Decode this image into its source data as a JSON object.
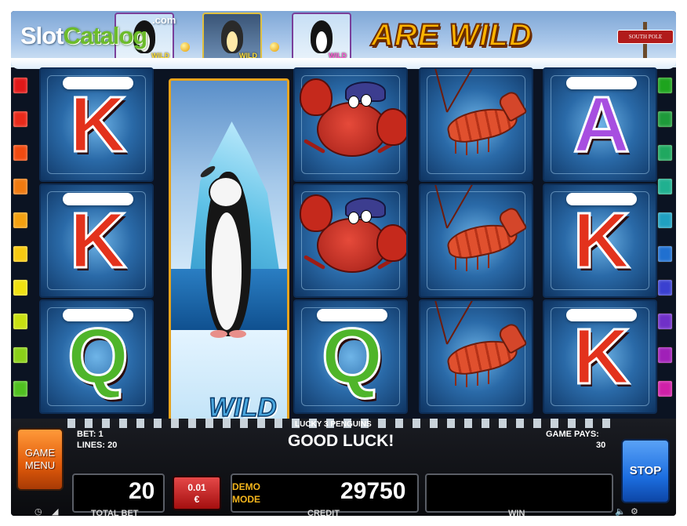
{
  "watermark": {
    "brand_a": "Slot",
    "brand_b": "Catalog",
    "suffix": ".com"
  },
  "header": {
    "headline": "ARE WILD",
    "sign": "SOUTH POLE",
    "wild_thumbs": [
      {
        "label": "WILD",
        "selected": false
      },
      {
        "label": "WILD",
        "selected": true
      },
      {
        "label": "WILD",
        "selected": false
      }
    ]
  },
  "reels": [
    {
      "symbols": [
        "K",
        "K",
        "Q"
      ]
    },
    {
      "symbols": [
        "WILD"
      ]
    },
    {
      "symbols": [
        "crab",
        "crab",
        "Q"
      ]
    },
    {
      "symbols": [
        "shrimp",
        "shrimp",
        "shrimp"
      ]
    },
    {
      "symbols": [
        "A",
        "K",
        "K"
      ]
    }
  ],
  "wild_label": "WILD",
  "line_marker_colors_left": [
    "#e01818",
    "#e82a1a",
    "#f04a10",
    "#f07a10",
    "#f4a010",
    "#f6c810",
    "#f0e010",
    "#c8e010",
    "#8ad018",
    "#50c020"
  ],
  "line_marker_colors_right": [
    "#1ea41e",
    "#1e9a3a",
    "#20a860",
    "#20b090",
    "#20a0c0",
    "#2070d0",
    "#3a40d0",
    "#7030c8",
    "#a020b8",
    "#d020a8"
  ],
  "panel": {
    "game_menu_line1": "GAME",
    "game_menu_line2": "MENU",
    "bet_label": "BET: 1",
    "lines_label": "LINES: 20",
    "game_title": "LUCKY 3 PENGUINS",
    "message": "GOOD LUCK!",
    "game_pays_label": "GAME PAYS:",
    "game_pays_value": "30",
    "total_bet_value": "20",
    "total_bet_caption": "TOTAL BET",
    "denomination_value": "0.01",
    "denomination_currency": "€",
    "demo_line1": "DEMO",
    "demo_line2": "MODE",
    "credit_value": "29750",
    "credit_caption": "CREDIT",
    "win_value": "",
    "win_caption": "WIN",
    "stop_label": "STOP"
  }
}
